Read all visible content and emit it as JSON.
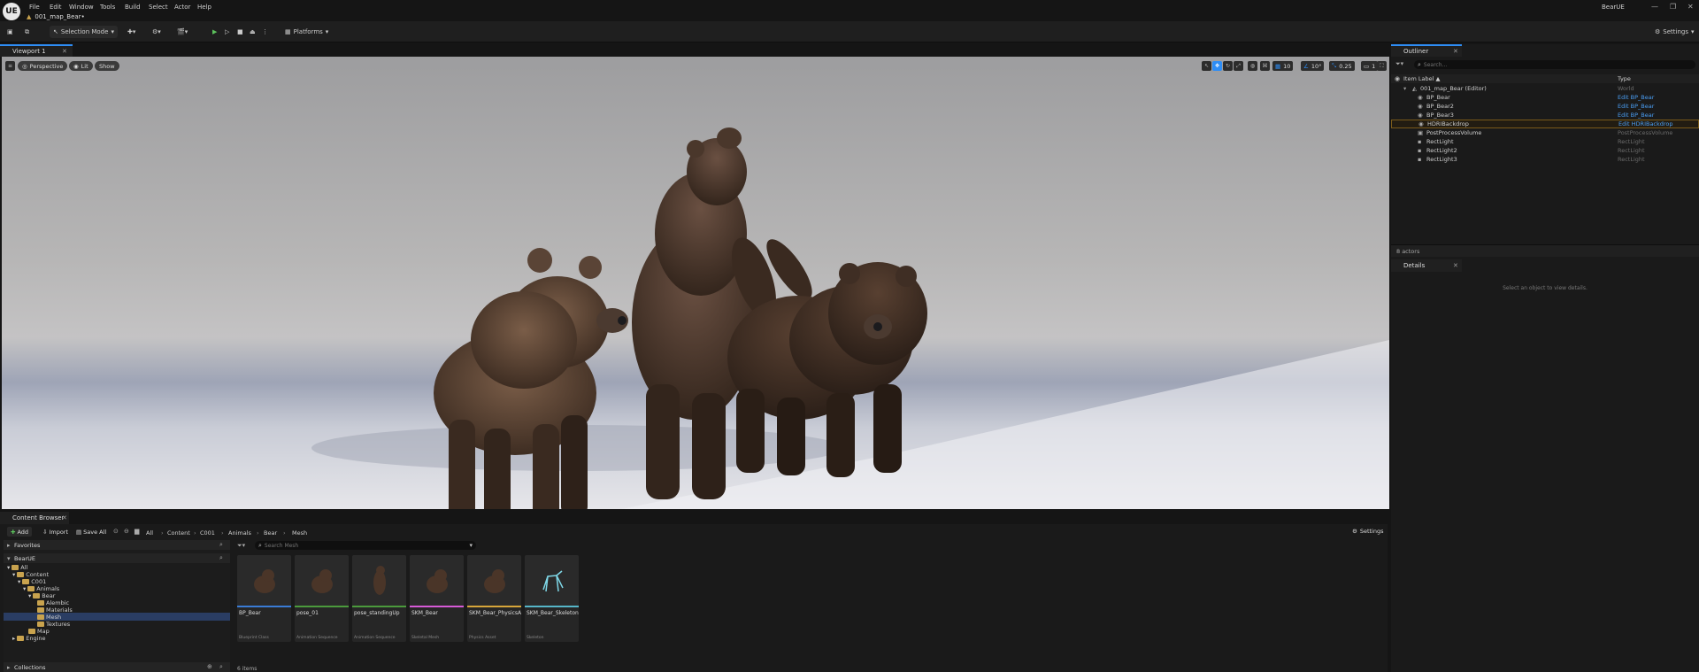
{
  "app": {
    "name": "BearUE",
    "logo_text": "UE"
  },
  "menu": [
    "File",
    "Edit",
    "Window",
    "Tools",
    "Build",
    "Select",
    "Actor",
    "Help"
  ],
  "level_tab": "001_map_Bear•",
  "toolbar": {
    "selection_mode": "Selection Mode",
    "platforms": "Platforms",
    "settings": "Settings"
  },
  "viewport": {
    "tab": "Viewport 1",
    "perspective": "Perspective",
    "lit": "Lit",
    "show": "Show",
    "grid_snap": "10",
    "angle_snap": "10°",
    "scale_snap": "0.25",
    "camera_speed": "1"
  },
  "outliner": {
    "tab": "Outliner",
    "search_placeholder": "Search...",
    "col_label": "Item Label ▲",
    "col_type": "Type",
    "rows": [
      {
        "label": "001_map_Bear (Editor)",
        "type": "World",
        "link": false
      },
      {
        "label": "BP_Bear",
        "type": "Edit BP_Bear",
        "link": true
      },
      {
        "label": "BP_Bear2",
        "type": "Edit BP_Bear",
        "link": true
      },
      {
        "label": "BP_Bear3",
        "type": "Edit BP_Bear",
        "link": true
      },
      {
        "label": "HDRIBackdrop",
        "type": "Edit HDRIBackdrop",
        "link": true
      },
      {
        "label": "PostProcessVolume",
        "type": "PostProcessVolume",
        "link": false
      },
      {
        "label": "RectLight",
        "type": "RectLight",
        "link": false
      },
      {
        "label": "RectLight2",
        "type": "RectLight",
        "link": false
      },
      {
        "label": "RectLight3",
        "type": "RectLight",
        "link": false
      }
    ],
    "actor_count": "8 actors"
  },
  "details": {
    "tab": "Details",
    "empty": "Select an object to view details."
  },
  "content_browser": {
    "tab": "Content Browser",
    "add": "Add",
    "import": "Import",
    "save_all": "Save All",
    "settings": "Settings",
    "breadcrumb": [
      "All",
      "Content",
      "C001",
      "Animals",
      "Bear",
      "Mesh"
    ],
    "favorites": "Favorites",
    "project": "BearUE",
    "search_placeholder": "Search Mesh",
    "tree": [
      "All",
      "Content",
      "C001",
      "Animals",
      "Bear",
      "Alembic",
      "Materials",
      "Mesh",
      "Textures",
      "Map",
      "Engine"
    ],
    "assets": [
      {
        "name": "BP_Bear",
        "type": "Blueprint Class",
        "color": "#3a7bd5"
      },
      {
        "name": "pose_01",
        "type": "Animation Sequence",
        "color": "#4b9a3c"
      },
      {
        "name": "pose_standingUp",
        "type": "Animation Sequence",
        "color": "#4b9a3c"
      },
      {
        "name": "SKM_Bear",
        "type": "Skeletal Mesh",
        "color": "#d65ad6"
      },
      {
        "name": "SKM_Bear_PhysicsAsset",
        "type": "Physics Asset",
        "color": "#d6a53a"
      },
      {
        "name": "SKM_Bear_Skeleton",
        "type": "Skeleton",
        "color": "#56b6c8"
      }
    ],
    "item_count": "6 items",
    "collections": "Collections"
  }
}
